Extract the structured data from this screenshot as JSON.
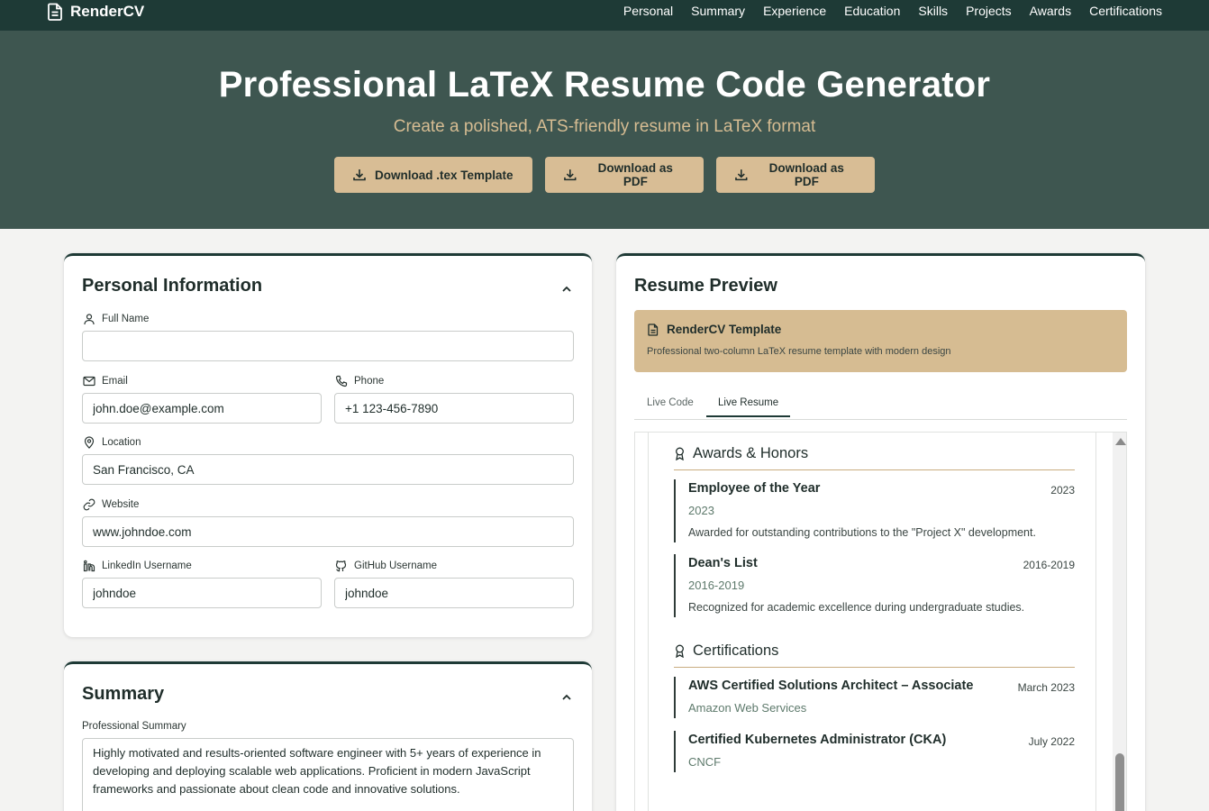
{
  "nav": {
    "logo_text": "RenderCV",
    "logo_icon": "file-text-icon",
    "links": [
      "Personal",
      "Summary",
      "Experience",
      "Education",
      "Skills",
      "Projects",
      "Awards",
      "Certifications"
    ]
  },
  "hero": {
    "title": "Professional LaTeX Resume Code Generator",
    "subtitle": "Create a polished, ATS-friendly resume in LaTeX format",
    "buttons": [
      {
        "label": "Download .tex Template",
        "icon": "download-icon"
      },
      {
        "label": "Download as PDF",
        "icon": "download-icon"
      },
      {
        "label": "Download as PDF",
        "icon": "download-icon"
      }
    ]
  },
  "personal": {
    "title": "Personal Information",
    "fields": {
      "full_name": {
        "label": "Full Name",
        "value": ""
      },
      "email": {
        "label": "Email",
        "value": "john.doe@example.com"
      },
      "phone": {
        "label": "Phone",
        "value": "+1 123-456-7890"
      },
      "location": {
        "label": "Location",
        "value": "San Francisco, CA"
      },
      "website": {
        "label": "Website",
        "value": "www.johndoe.com"
      },
      "linkedin": {
        "label": "LinkedIn Username",
        "value": "johndoe"
      },
      "github": {
        "label": "GitHub Username",
        "value": "johndoe"
      }
    }
  },
  "summary": {
    "title": "Summary",
    "label": "Professional Summary",
    "value": "Highly motivated and results-oriented software engineer with 5+ years of experience in developing and deploying scalable web applications. Proficient in modern JavaScript frameworks and passionate about clean code and innovative solutions."
  },
  "preview": {
    "title": "Resume Preview",
    "template": {
      "name": "RenderCV Template",
      "description": "Professional two-column LaTeX resume template with modern design"
    },
    "tabs": [
      "Live Code",
      "Live Resume"
    ],
    "active_tab": "Live Resume",
    "awards": {
      "heading": "Awards & Honors",
      "items": [
        {
          "title": "Employee of the Year",
          "date": "2023",
          "sub": "2023",
          "desc": "Awarded for outstanding contributions to the \"Project X\" development."
        },
        {
          "title": "Dean's List",
          "date": "2016-2019",
          "sub": "2016-2019",
          "desc": "Recognized for academic excellence during undergraduate studies."
        }
      ]
    },
    "certifications": {
      "heading": "Certifications",
      "items": [
        {
          "title": "AWS Certified Solutions Architect – Associate",
          "date": "March 2023",
          "sub": "Amazon Web Services"
        },
        {
          "title": "Certified Kubernetes Administrator (CKA)",
          "date": "July 2022",
          "sub": "CNCF"
        }
      ]
    }
  },
  "colors": {
    "nav_bg": "#1e3a36",
    "hero_bg": "#3e5650",
    "accent_tan": "#d6bc92",
    "muted_green": "#5e7a6c"
  }
}
